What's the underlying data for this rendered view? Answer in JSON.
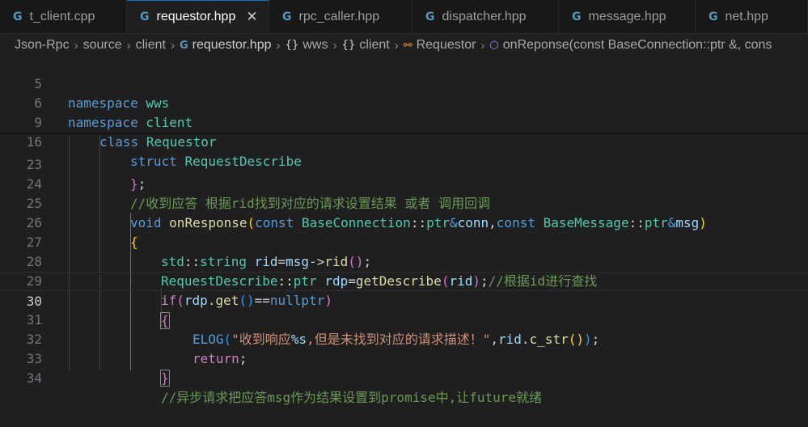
{
  "tabs": [
    {
      "label": "t_client.cpp",
      "icon": "c-plus-plus-icon",
      "active": false
    },
    {
      "label": "requestor.hpp",
      "icon": "c-plus-plus-icon",
      "active": true
    },
    {
      "label": "rpc_caller.hpp",
      "icon": "c-plus-plus-icon",
      "active": false
    },
    {
      "label": "dispatcher.hpp",
      "icon": "c-plus-plus-icon",
      "active": false
    },
    {
      "label": "message.hpp",
      "icon": "c-plus-plus-icon",
      "active": false
    },
    {
      "label": "net.hpp",
      "icon": "c-plus-plus-icon",
      "active": false
    }
  ],
  "breadcrumb": {
    "items": [
      "Json-Rpc",
      "source",
      "client",
      "requestor.hpp",
      "wws",
      "client",
      "Requestor",
      "onReponse(const BaseConnection::ptr &, cons"
    ]
  },
  "sticky": {
    "lines": [
      {
        "num": "5",
        "kw": "namespace",
        "name": "wws"
      },
      {
        "num": "6",
        "kw": "namespace",
        "name": "client"
      },
      {
        "num": "9",
        "kw": "class",
        "name": "Requestor"
      },
      {
        "num": "16",
        "kw": "struct",
        "name": "RequestDescribe"
      }
    ]
  },
  "code": {
    "current_line": "30",
    "lines": [
      {
        "num": "23",
        "text": "};"
      },
      {
        "num": "24",
        "text": "//收到应答 根据rid找到对应的请求设置结果 或者 调用回调"
      },
      {
        "num": "25",
        "text": "void onResponse(const BaseConnection::ptr&conn,const BaseMessage::ptr&msg)"
      },
      {
        "num": "26",
        "text": "{"
      },
      {
        "num": "27",
        "text": "std::string rid=msg->rid();"
      },
      {
        "num": "28",
        "text": "RequestDescribe::ptr rdp=getDescribe(rid);//根据id进行查找"
      },
      {
        "num": "29",
        "text": "if(rdp.get()==nullptr)"
      },
      {
        "num": "30",
        "text": "{"
      },
      {
        "num": "31",
        "text": "ELOG(\"收到响应%s,但是未找到对应的请求描述！\",rid.c_str());"
      },
      {
        "num": "32",
        "text": "return;"
      },
      {
        "num": "33",
        "text": "}"
      },
      {
        "num": "34",
        "text": "//异步请求把应答msg作为结果设置到promise中,让future就绪"
      }
    ]
  },
  "colors": {
    "background": "#1f1f1f",
    "keyword": "#569cd6",
    "type": "#4ec9b0",
    "function": "#dcdcaa",
    "variable": "#9cdcfe",
    "comment": "#6a9955",
    "string": "#ce9178"
  }
}
